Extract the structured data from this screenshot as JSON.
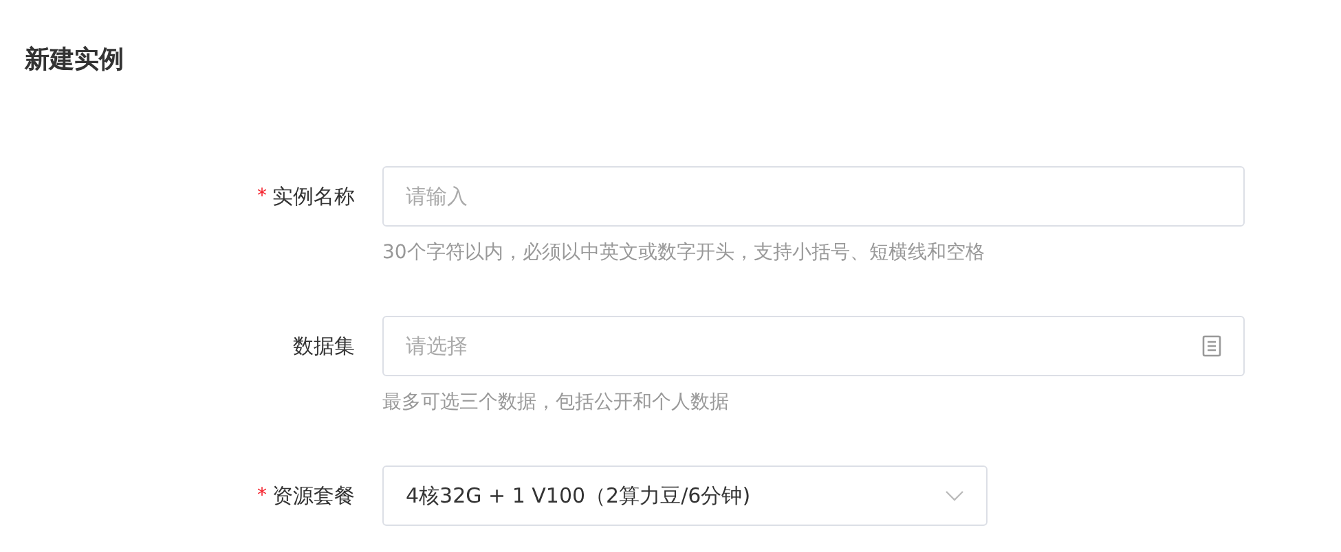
{
  "title": "新建实例",
  "fields": [
    {
      "label": "实例名称",
      "required_mark": "*",
      "kind": "text",
      "placeholder": "请输入",
      "hint": "30个字符以内，必须以中英文或数字开头，支持小括号、短横线和空格"
    },
    {
      "label": "数据集",
      "kind": "picker",
      "placeholder": "请选择",
      "hint": "最多可选三个数据，包括公开和个人数据"
    },
    {
      "label": "资源套餐",
      "required_mark": "*",
      "kind": "select",
      "value": "4核32G + 1 V100（2算力豆/6分钟)"
    }
  ]
}
